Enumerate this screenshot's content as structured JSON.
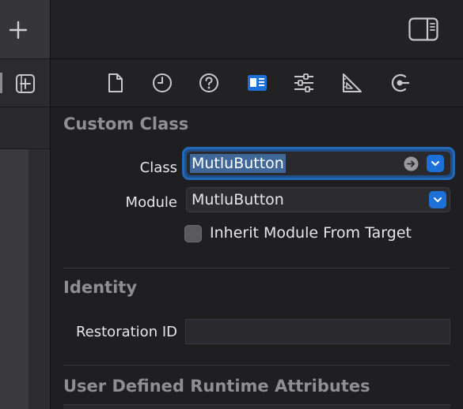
{
  "left_panel": {
    "add_icon": "plus-icon",
    "library_icon": "add-library-icon"
  },
  "inspector": {
    "toolbar": {
      "sidebar_toggle_icon": "right-sidebar-toggle-icon"
    },
    "tabs": [
      {
        "name": "file-inspector",
        "icon": "document-icon",
        "selected": false
      },
      {
        "name": "history-inspector",
        "icon": "clock-icon",
        "selected": false
      },
      {
        "name": "quick-help",
        "icon": "question-icon",
        "selected": false
      },
      {
        "name": "identity-inspector",
        "icon": "identity-card-icon",
        "selected": true
      },
      {
        "name": "attributes-inspector",
        "icon": "sliders-icon",
        "selected": false
      },
      {
        "name": "size-inspector",
        "icon": "ruler-icon",
        "selected": false
      },
      {
        "name": "connections-inspector",
        "icon": "connection-arrow-icon",
        "selected": false
      }
    ],
    "custom_class": {
      "title": "Custom Class",
      "class_label": "Class",
      "class_value": "MutluButton",
      "module_label": "Module",
      "module_value": "MutluButton",
      "inherit_label": "Inherit Module From Target",
      "inherit_checked": false
    },
    "identity": {
      "title": "Identity",
      "restoration_id_label": "Restoration ID",
      "restoration_id_value": ""
    },
    "user_defined": {
      "title": "User Defined Runtime Attributes"
    }
  },
  "colors": {
    "accent": "#1d70d8",
    "selection": "#3f6797",
    "section_title": "#8e8e93",
    "background": "#1f1f22"
  }
}
